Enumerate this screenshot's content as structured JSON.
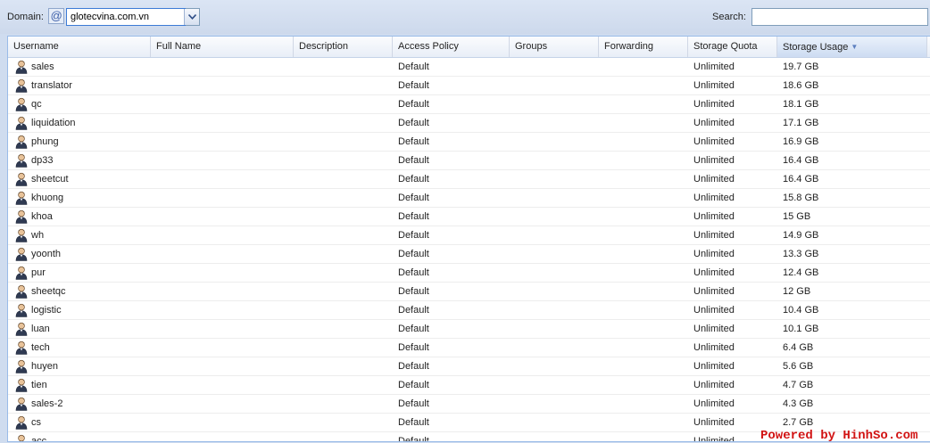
{
  "toolbar": {
    "domain_label": "Domain:",
    "domain_value": "glotecvina.com.vn",
    "search_label": "Search:",
    "search_value": ""
  },
  "columns": [
    "Username",
    "Full Name",
    "Description",
    "Access Policy",
    "Groups",
    "Forwarding",
    "Storage Quota",
    "Storage Usage"
  ],
  "rows": [
    {
      "username": "sales",
      "full_name": "",
      "description": "",
      "access_policy": "Default",
      "groups": "",
      "forwarding": "",
      "quota": "Unlimited",
      "usage": "19.7 GB"
    },
    {
      "username": "translator",
      "full_name": "",
      "description": "",
      "access_policy": "Default",
      "groups": "",
      "forwarding": "",
      "quota": "Unlimited",
      "usage": "18.6 GB"
    },
    {
      "username": "qc",
      "full_name": "",
      "description": "",
      "access_policy": "Default",
      "groups": "",
      "forwarding": "",
      "quota": "Unlimited",
      "usage": "18.1 GB"
    },
    {
      "username": "liquidation",
      "full_name": "",
      "description": "",
      "access_policy": "Default",
      "groups": "",
      "forwarding": "",
      "quota": "Unlimited",
      "usage": "17.1 GB"
    },
    {
      "username": "phung",
      "full_name": "",
      "description": "",
      "access_policy": "Default",
      "groups": "",
      "forwarding": "",
      "quota": "Unlimited",
      "usage": "16.9 GB"
    },
    {
      "username": "dp33",
      "full_name": "",
      "description": "",
      "access_policy": "Default",
      "groups": "",
      "forwarding": "",
      "quota": "Unlimited",
      "usage": "16.4 GB"
    },
    {
      "username": "sheetcut",
      "full_name": "",
      "description": "",
      "access_policy": "Default",
      "groups": "",
      "forwarding": "",
      "quota": "Unlimited",
      "usage": "16.4 GB"
    },
    {
      "username": "khuong",
      "full_name": "",
      "description": "",
      "access_policy": "Default",
      "groups": "",
      "forwarding": "",
      "quota": "Unlimited",
      "usage": "15.8 GB"
    },
    {
      "username": "khoa",
      "full_name": "",
      "description": "",
      "access_policy": "Default",
      "groups": "",
      "forwarding": "",
      "quota": "Unlimited",
      "usage": "15 GB"
    },
    {
      "username": "wh",
      "full_name": "",
      "description": "",
      "access_policy": "Default",
      "groups": "",
      "forwarding": "",
      "quota": "Unlimited",
      "usage": "14.9 GB"
    },
    {
      "username": "yoonth",
      "full_name": "",
      "description": "",
      "access_policy": "Default",
      "groups": "",
      "forwarding": "",
      "quota": "Unlimited",
      "usage": "13.3 GB"
    },
    {
      "username": "pur",
      "full_name": "",
      "description": "",
      "access_policy": "Default",
      "groups": "",
      "forwarding": "",
      "quota": "Unlimited",
      "usage": "12.4 GB"
    },
    {
      "username": "sheetqc",
      "full_name": "",
      "description": "",
      "access_policy": "Default",
      "groups": "",
      "forwarding": "",
      "quota": "Unlimited",
      "usage": "12 GB"
    },
    {
      "username": "logistic",
      "full_name": "",
      "description": "",
      "access_policy": "Default",
      "groups": "",
      "forwarding": "",
      "quota": "Unlimited",
      "usage": "10.4 GB"
    },
    {
      "username": "luan",
      "full_name": "",
      "description": "",
      "access_policy": "Default",
      "groups": "",
      "forwarding": "",
      "quota": "Unlimited",
      "usage": "10.1 GB"
    },
    {
      "username": "tech",
      "full_name": "",
      "description": "",
      "access_policy": "Default",
      "groups": "",
      "forwarding": "",
      "quota": "Unlimited",
      "usage": "6.4 GB"
    },
    {
      "username": "huyen",
      "full_name": "",
      "description": "",
      "access_policy": "Default",
      "groups": "",
      "forwarding": "",
      "quota": "Unlimited",
      "usage": "5.6 GB"
    },
    {
      "username": "tien",
      "full_name": "",
      "description": "",
      "access_policy": "Default",
      "groups": "",
      "forwarding": "",
      "quota": "Unlimited",
      "usage": "4.7 GB"
    },
    {
      "username": "sales-2",
      "full_name": "",
      "description": "",
      "access_policy": "Default",
      "groups": "",
      "forwarding": "",
      "quota": "Unlimited",
      "usage": "4.3 GB"
    },
    {
      "username": "cs",
      "full_name": "",
      "description": "",
      "access_policy": "Default",
      "groups": "",
      "forwarding": "",
      "quota": "Unlimited",
      "usage": "2.7 GB"
    },
    {
      "username": "acc",
      "full_name": "",
      "description": "",
      "access_policy": "Default",
      "groups": "",
      "forwarding": "",
      "quota": "Unlimited",
      "usage": ""
    }
  ],
  "watermark": "Powered by HinhSo.com"
}
